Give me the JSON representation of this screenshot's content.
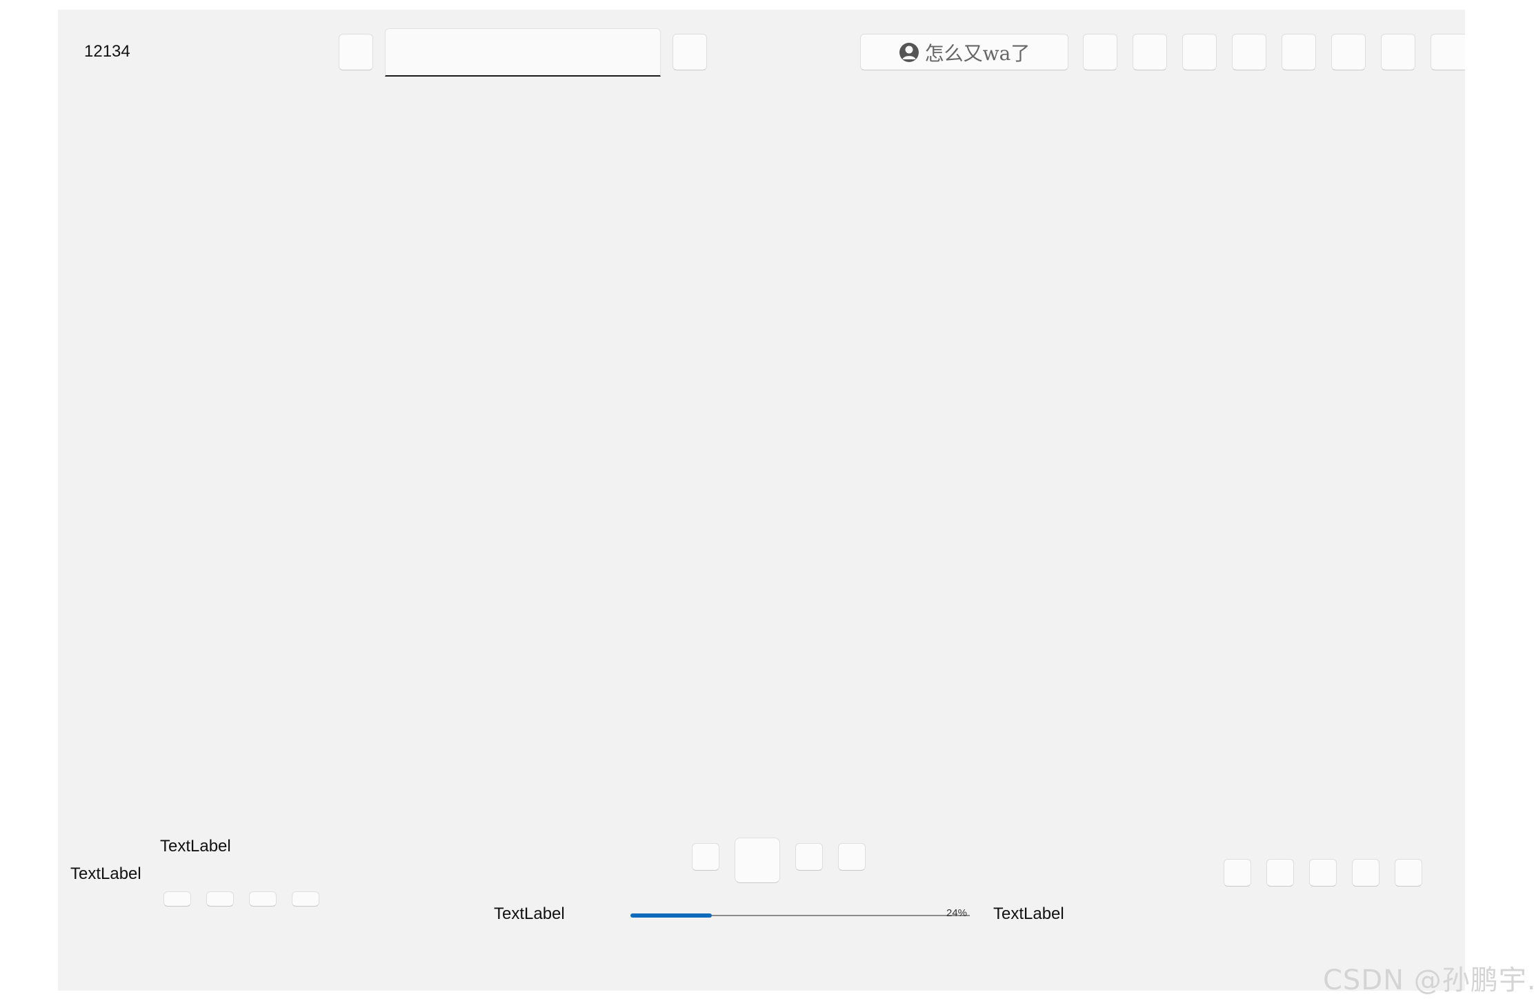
{
  "header": {
    "title": "12134",
    "search": {
      "value": "",
      "placeholder": ""
    },
    "user_button": {
      "icon": "user-avatar-icon",
      "label": "怎么又wa了"
    }
  },
  "bottom": {
    "label_left": "TextLabel",
    "label_top": "TextLabel",
    "progress": {
      "label_before": "TextLabel",
      "value": 24,
      "percent_text": "24%",
      "label_after": "TextLabel",
      "fill_color": "#0f6cbd"
    }
  },
  "watermark": "CSDN @孙鹏宇."
}
